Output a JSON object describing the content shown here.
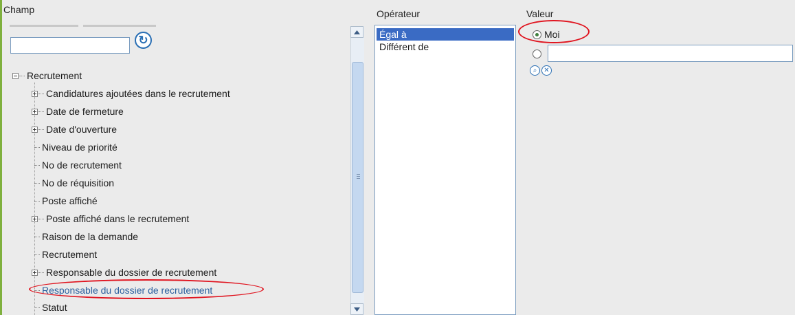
{
  "champ": {
    "header": "Champ",
    "search": {
      "value": "",
      "placeholder": ""
    },
    "tree": {
      "root_label": "Recrutement",
      "items": [
        {
          "label": "Candidatures ajoutées dans le recrutement",
          "expandable": true
        },
        {
          "label": "Date de fermeture",
          "expandable": true
        },
        {
          "label": "Date d'ouverture",
          "expandable": true
        },
        {
          "label": "Niveau de priorité",
          "expandable": false
        },
        {
          "label": "No de recrutement",
          "expandable": false
        },
        {
          "label": "No de réquisition",
          "expandable": false
        },
        {
          "label": "Poste affiché",
          "expandable": false
        },
        {
          "label": "Poste affiché dans le recrutement",
          "expandable": true
        },
        {
          "label": "Raison de la demande",
          "expandable": false
        },
        {
          "label": "Recrutement",
          "expandable": false
        },
        {
          "label": "Responsable du dossier de recrutement",
          "expandable": true
        },
        {
          "label": "Responsable du dossier de recrutement",
          "expandable": false,
          "selected": true
        },
        {
          "label": "Statut",
          "expandable": false
        }
      ]
    }
  },
  "operateur": {
    "header": "Opérateur",
    "options": [
      {
        "label": "Égal à",
        "selected": true
      },
      {
        "label": "Différent de",
        "selected": false
      }
    ]
  },
  "valeur": {
    "header": "Valeur",
    "radio_me_label": "Moi",
    "radio_me_checked": true,
    "radio_other_checked": false,
    "other_input": {
      "value": "",
      "placeholder": ""
    },
    "icons": [
      "refresh-icon",
      "search-icon",
      "clear-icon"
    ]
  },
  "colors": {
    "selection": "#3a6bc4",
    "selected_text": "#2b5f9e",
    "highlight_oval": "#e0141f",
    "accent_border": "#7fb03e"
  }
}
